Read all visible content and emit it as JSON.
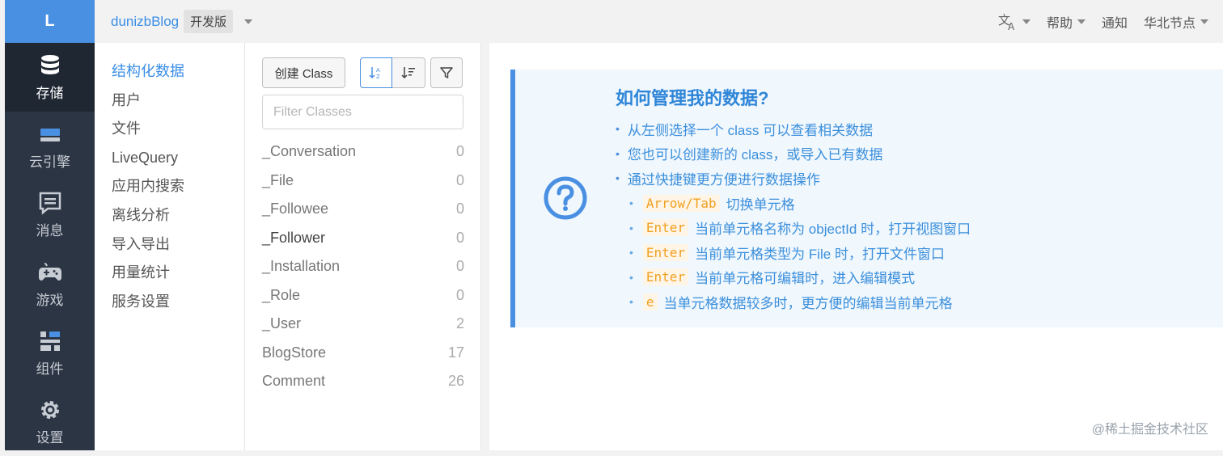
{
  "logo": "L",
  "leftnav": [
    {
      "label": "存储",
      "icon": "database-icon",
      "active": true
    },
    {
      "label": "云引擎",
      "icon": "cloud-engine-icon"
    },
    {
      "label": "消息",
      "icon": "message-icon"
    },
    {
      "label": "游戏",
      "icon": "gamepad-icon"
    },
    {
      "label": "组件",
      "icon": "components-icon"
    },
    {
      "label": "设置",
      "icon": "gear-icon"
    }
  ],
  "header": {
    "app_name": "dunizbBlog",
    "env": "开发版",
    "translate_icon": "translate-icon",
    "help": "帮助",
    "notify": "通知",
    "region": "华北节点"
  },
  "submenu": [
    "结构化数据",
    "用户",
    "文件",
    "LiveQuery",
    "应用内搜索",
    "离线分析",
    "导入导出",
    "用量统计",
    "服务设置"
  ],
  "classpanel": {
    "create_label": "创建 Class",
    "filter_placeholder": "Filter Classes",
    "classes": [
      {
        "name": "_Conversation",
        "count": "0"
      },
      {
        "name": "_File",
        "count": "0"
      },
      {
        "name": "_Followee",
        "count": "0"
      },
      {
        "name": "_Follower",
        "count": "0"
      },
      {
        "name": "_Installation",
        "count": "0"
      },
      {
        "name": "_Role",
        "count": "0"
      },
      {
        "name": "_User",
        "count": "2"
      },
      {
        "name": "BlogStore",
        "count": "17"
      },
      {
        "name": "Comment",
        "count": "26"
      }
    ]
  },
  "help": {
    "title": "如何管理我的数据?",
    "items": [
      "从左侧选择一个 class 可以查看相关数据",
      "您也可以创建新的 class，或导入已有数据",
      "通过快捷键更方便进行数据操作"
    ],
    "shortcuts": [
      {
        "key": "Arrow/Tab",
        "desc": "切换单元格"
      },
      {
        "key": "Enter",
        "desc": "当前单元格名称为 objectId 时，打开视图窗口"
      },
      {
        "key": "Enter",
        "desc": "当前单元格类型为 File 时，打开文件窗口"
      },
      {
        "key": "Enter",
        "desc": "当前单元格可编辑时，进入编辑模式"
      },
      {
        "key": "e",
        "desc": "当单元格数据较多时，更方便的编辑当前单元格"
      }
    ]
  },
  "watermark": "@稀土掘金技术社区"
}
